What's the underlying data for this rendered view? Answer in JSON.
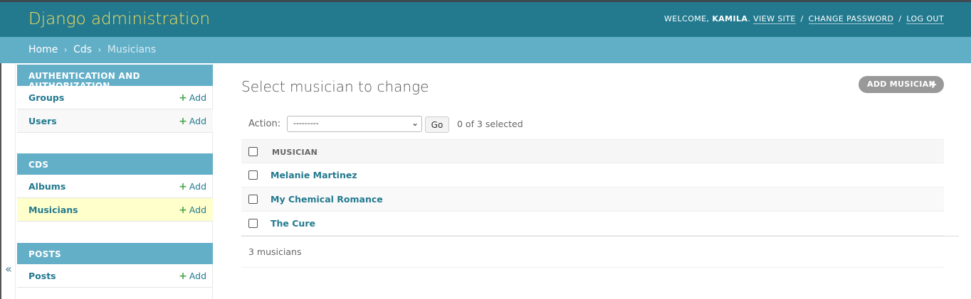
{
  "header": {
    "site_name": "Django administration",
    "welcome": "WELCOME,",
    "username": "KAMILA",
    "view_site": "VIEW SITE",
    "change_password": "CHANGE PASSWORD",
    "log_out": "LOG OUT",
    "separator": "/"
  },
  "breadcrumbs": {
    "home": "Home",
    "app": "Cds",
    "current": "Musicians",
    "arrow": "›"
  },
  "sidebar": {
    "toggle_icon": "«",
    "add_label": "Add",
    "add_icon": "+",
    "modules": [
      {
        "caption": "AUTHENTICATION AND AUTHORIZATION",
        "models": [
          {
            "name": "Groups"
          },
          {
            "name": "Users"
          }
        ]
      },
      {
        "caption": "CDS",
        "models": [
          {
            "name": "Albums"
          },
          {
            "name": "Musicians"
          }
        ]
      },
      {
        "caption": "POSTS",
        "models": [
          {
            "name": "Posts"
          }
        ]
      }
    ]
  },
  "main": {
    "title": "Select musician to change",
    "add_button": "ADD MUSICIAN",
    "add_icon": "+",
    "actions": {
      "label": "Action:",
      "selected_value": "---------",
      "go": "Go",
      "selection_count": "0 of 3 selected"
    },
    "table": {
      "column_header": "MUSICIAN",
      "rows": [
        "Melanie Martinez",
        "My Chemical Romance",
        "The Cure"
      ]
    },
    "paginator": "3 musicians"
  },
  "colors": {
    "header_bg": "#237a8f",
    "site_name": "#f5dd5d",
    "breadcrumb_bg": "#61afc7",
    "link": "#237a8f",
    "add_plus": "#4ca54c",
    "selected_row": "#ffffcc"
  }
}
